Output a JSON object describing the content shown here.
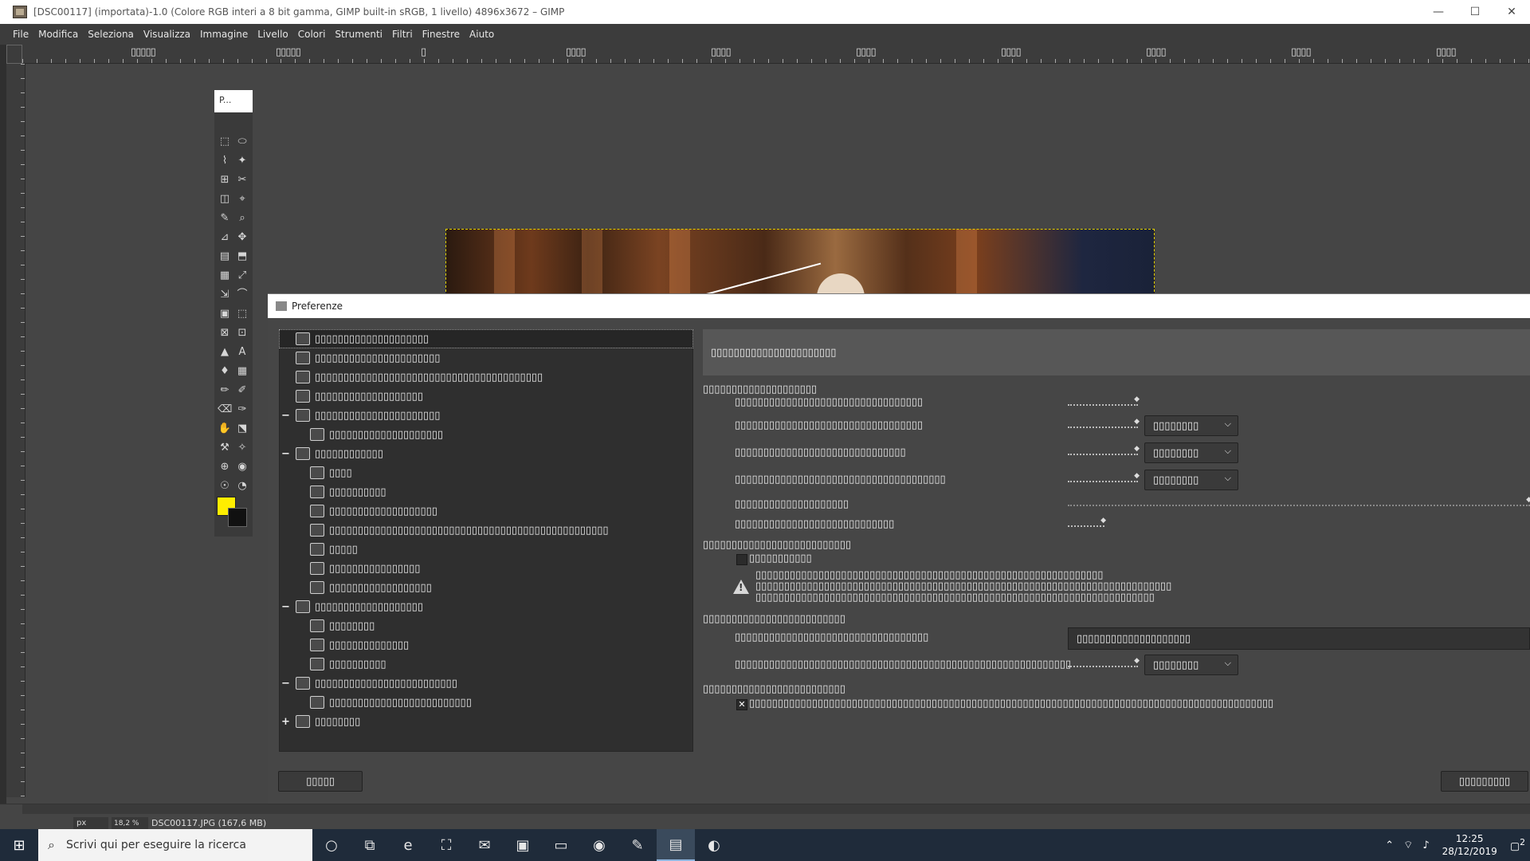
{
  "window": {
    "title": "[DSC00117] (importata)-1.0 (Colore RGB interi a 8 bit gamma, GIMP built-in sRGB, 1 livello) 4896x3672 – GIMP",
    "minimize": "—",
    "maximize": "☐",
    "close": "✕"
  },
  "menu": [
    "File",
    "Modifica",
    "Seleziona",
    "Visualizza",
    "Immagine",
    "Livello",
    "Colori",
    "Strumenti",
    "Filtri",
    "Finestre",
    "Aiuto"
  ],
  "ruler": {
    "labels": [
      "▯▯▯▯▯",
      "▯▯▯▯▯",
      "▯",
      "▯▯▯▯",
      "▯▯▯▯",
      "▯▯▯▯",
      "▯▯▯▯",
      "▯▯▯▯",
      "▯▯▯▯",
      "▯▯▯▯"
    ]
  },
  "toolbox": {
    "tab_label": "P...",
    "tools": [
      "⬚",
      "⬭",
      "⌇",
      "✦",
      "⊞",
      "✂",
      "◫",
      "⌖",
      "✎",
      "⌕",
      "⊿",
      "✥",
      "▤",
      "⬒",
      "▦",
      "⤢",
      "⇲",
      "⌒",
      "▣",
      "⬚",
      "⊠",
      "⊡",
      "▲",
      "A",
      "♦",
      "▦",
      "✏",
      "✐",
      "⌫",
      "✑",
      "✋",
      "⬔",
      "⚒",
      "✧",
      "⊕",
      "◉",
      "☉",
      "◔"
    ],
    "fg_color": "#ffee00",
    "bg_color": "#111111"
  },
  "preferences": {
    "title": "Preferenze",
    "tree": [
      {
        "label": "▯▯▯▯▯▯▯▯▯▯▯▯▯▯▯▯▯▯▯▯",
        "indent": 0,
        "expander": "",
        "selected": true
      },
      {
        "label": "▯▯▯▯▯▯▯▯▯▯▯▯▯▯▯▯▯▯▯▯▯▯",
        "indent": 0,
        "expander": ""
      },
      {
        "label": "▯▯▯▯▯▯▯▯▯▯▯▯▯▯▯▯▯▯▯▯▯▯▯▯▯▯▯▯▯▯▯▯▯▯▯▯▯▯▯▯",
        "indent": 0,
        "expander": ""
      },
      {
        "label": "▯▯▯▯▯▯▯▯▯▯▯▯▯▯▯▯▯▯▯",
        "indent": 0,
        "expander": ""
      },
      {
        "label": "▯▯▯▯▯▯▯▯▯▯▯▯▯▯▯▯▯▯▯▯▯▯",
        "indent": 0,
        "expander": "−"
      },
      {
        "label": "▯▯▯▯▯▯▯▯▯▯▯▯▯▯▯▯▯▯▯▯",
        "indent": 1,
        "expander": ""
      },
      {
        "label": "▯▯▯▯▯▯▯▯▯▯▯▯",
        "indent": 0,
        "expander": "−"
      },
      {
        "label": "▯▯▯▯",
        "indent": 1,
        "expander": ""
      },
      {
        "label": "▯▯▯▯▯▯▯▯▯▯",
        "indent": 1,
        "expander": ""
      },
      {
        "label": "▯▯▯▯▯▯▯▯▯▯▯▯▯▯▯▯▯▯▯",
        "indent": 1,
        "expander": ""
      },
      {
        "label": "▯▯▯▯▯▯▯▯▯▯▯▯▯▯▯▯▯▯▯▯▯▯▯▯▯▯▯▯▯▯▯▯▯▯▯▯▯▯▯▯▯▯▯▯▯▯▯▯▯",
        "indent": 1,
        "expander": ""
      },
      {
        "label": "▯▯▯▯▯",
        "indent": 1,
        "expander": ""
      },
      {
        "label": "▯▯▯▯▯▯▯▯▯▯▯▯▯▯▯▯",
        "indent": 1,
        "expander": ""
      },
      {
        "label": "▯▯▯▯▯▯▯▯▯▯▯▯▯▯▯▯▯▯",
        "indent": 1,
        "expander": ""
      },
      {
        "label": "▯▯▯▯▯▯▯▯▯▯▯▯▯▯▯▯▯▯▯",
        "indent": 0,
        "expander": "−"
      },
      {
        "label": "▯▯▯▯▯▯▯▯",
        "indent": 1,
        "expander": ""
      },
      {
        "label": "▯▯▯▯▯▯▯▯▯▯▯▯▯▯",
        "indent": 1,
        "expander": ""
      },
      {
        "label": "▯▯▯▯▯▯▯▯▯▯",
        "indent": 1,
        "expander": ""
      },
      {
        "label": "▯▯▯▯▯▯▯▯▯▯▯▯▯▯▯▯▯▯▯▯▯▯▯▯▯",
        "indent": 0,
        "expander": "−"
      },
      {
        "label": "▯▯▯▯▯▯▯▯▯▯▯▯▯▯▯▯▯▯▯▯▯▯▯▯▯",
        "indent": 1,
        "expander": ""
      },
      {
        "label": "▯▯▯▯▯▯▯▯",
        "indent": 0,
        "expander": "+"
      }
    ],
    "panel_title": "▯▯▯▯▯▯▯▯▯▯▯▯▯▯▯▯▯▯▯▯▯▯",
    "section1": "▯▯▯▯▯▯▯▯▯▯▯▯▯▯▯▯▯▯▯▯",
    "row1": "▯▯▯▯▯▯▯▯▯▯▯▯▯▯▯▯▯▯▯▯▯▯▯▯▯▯▯▯▯▯▯▯▯",
    "row2": "▯▯▯▯▯▯▯▯▯▯▯▯▯▯▯▯▯▯▯▯▯▯▯▯▯▯▯▯▯▯▯▯▯",
    "row3": "▯▯▯▯▯▯▯▯▯▯▯▯▯▯▯▯▯▯▯▯▯▯▯▯▯▯▯▯▯▯",
    "row4": "▯▯▯▯▯▯▯▯▯▯▯▯▯▯▯▯▯▯▯▯▯▯▯▯▯▯▯▯▯▯▯▯▯▯▯▯▯",
    "row5": "▯▯▯▯▯▯▯▯▯▯▯▯▯▯▯▯▯▯▯▯",
    "row6": "▯▯▯▯▯▯▯▯▯▯▯▯▯▯▯▯▯▯▯▯▯▯▯▯▯▯▯▯",
    "combo_label": "▯▯▯▯▯▯▯▯",
    "caret": "⌵",
    "section2": "▯▯▯▯▯▯▯▯▯▯▯▯▯▯▯▯▯▯▯▯▯▯▯▯▯▯",
    "check1": "▯▯▯▯▯▯▯▯▯▯▯",
    "warning1": "▯▯▯▯▯▯▯▯▯▯▯▯▯▯▯▯▯▯▯▯▯▯▯▯▯▯▯▯▯▯▯▯▯▯▯▯▯▯▯▯▯▯▯▯▯▯▯▯▯▯▯▯▯▯▯▯▯▯▯▯▯",
    "warning2": "▯▯▯▯▯▯▯▯▯▯▯▯▯▯▯▯▯▯▯▯▯▯▯▯▯▯▯▯▯▯▯▯▯▯▯▯▯▯▯▯▯▯▯▯▯▯▯▯▯▯▯▯▯▯▯▯▯▯▯▯▯▯▯▯▯▯▯▯▯▯▯▯▯",
    "warning3": "▯▯▯▯▯▯▯▯▯▯▯▯▯▯▯▯▯▯▯▯▯▯▯▯▯▯▯▯▯▯▯▯▯▯▯▯▯▯▯▯▯▯▯▯▯▯▯▯▯▯▯▯▯▯▯▯▯▯▯▯▯▯▯▯▯▯▯▯▯▯",
    "section3": "▯▯▯▯▯▯▯▯▯▯▯▯▯▯▯▯▯▯▯▯▯▯▯▯▯",
    "row7": "▯▯▯▯▯▯▯▯▯▯▯▯▯▯▯▯▯▯▯▯▯▯▯▯▯▯▯▯▯▯▯▯▯▯",
    "entry_value": "▯▯▯▯▯▯▯▯▯▯▯▯▯▯▯▯▯▯▯▯",
    "row8": "▯▯▯▯▯▯▯▯▯▯▯▯▯▯▯▯▯▯▯▯▯▯▯▯▯▯▯▯▯▯▯▯▯▯▯▯▯▯▯▯▯▯▯▯▯▯▯▯▯▯▯▯▯▯▯▯▯▯▯",
    "section4": "▯▯▯▯▯▯▯▯▯▯▯▯▯▯▯▯▯▯▯▯▯▯▯▯▯",
    "check2_mark": "✕",
    "check2": "▯▯▯▯▯▯▯▯▯▯▯▯▯▯▯▯▯▯▯▯▯▯▯▯▯▯▯▯▯▯▯▯▯▯▯▯▯▯▯▯▯▯▯▯▯▯▯▯▯▯▯▯▯▯▯▯▯▯▯▯▯▯▯▯▯▯▯▯▯▯▯▯▯▯▯▯▯▯▯▯▯▯▯▯▯▯▯▯▯▯▯▯",
    "btn_left": "▯▯▯▯▯",
    "btn_right": "▯▯▯▯▯▯▯▯▯"
  },
  "status": {
    "unit": "px",
    "zoom": "18,2 %",
    "file": "DSC00117.JPG (167,6 MB)"
  },
  "taskbar": {
    "search_placeholder": "Scrivi qui per eseguire la ricerca",
    "icons": [
      "cortana-icon",
      "task-view-icon",
      "edge-icon",
      "store-icon",
      "mail-icon",
      "outlook-icon",
      "file-explorer-icon",
      "chrome-icon",
      "gimp-app-icon",
      "gimp-window-icon",
      "app-icon"
    ],
    "time": "12:25",
    "date": "28/12/2019",
    "notification_count": "2"
  }
}
